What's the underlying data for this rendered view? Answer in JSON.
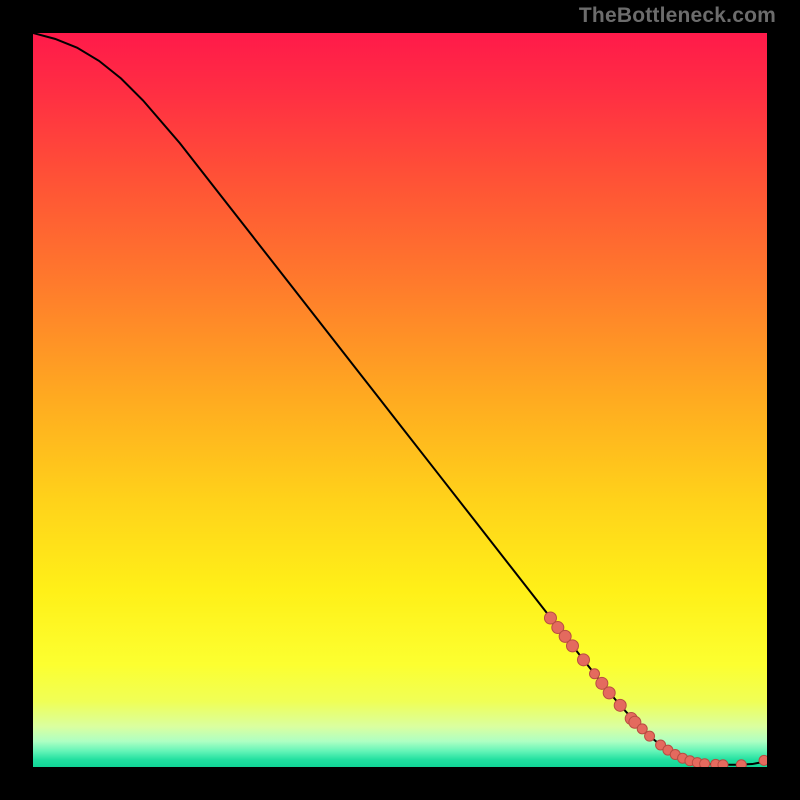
{
  "watermark": "TheBottleneck.com",
  "colors": {
    "curve": "#000000",
    "marker_fill": "#e46a5e",
    "marker_stroke": "#b94c42",
    "gradient_stops": [
      {
        "offset": 0.0,
        "color": "#ff1a4a"
      },
      {
        "offset": 0.08,
        "color": "#ff2e43"
      },
      {
        "offset": 0.2,
        "color": "#ff5236"
      },
      {
        "offset": 0.34,
        "color": "#ff7a2c"
      },
      {
        "offset": 0.5,
        "color": "#ffab20"
      },
      {
        "offset": 0.64,
        "color": "#ffd31a"
      },
      {
        "offset": 0.76,
        "color": "#fff018"
      },
      {
        "offset": 0.86,
        "color": "#fcff30"
      },
      {
        "offset": 0.91,
        "color": "#f0ff55"
      },
      {
        "offset": 0.945,
        "color": "#daffa0"
      },
      {
        "offset": 0.965,
        "color": "#aeffc3"
      },
      {
        "offset": 0.978,
        "color": "#66f5b8"
      },
      {
        "offset": 0.99,
        "color": "#22e0a0"
      },
      {
        "offset": 1.0,
        "color": "#10d596"
      }
    ]
  },
  "chart_data": {
    "type": "line",
    "title": "",
    "xlabel": "",
    "ylabel": "",
    "xlim": [
      0,
      100
    ],
    "ylim": [
      0,
      100
    ],
    "series": [
      {
        "name": "bottleneck-curve",
        "x": [
          0,
          3,
          6,
          9,
          12,
          15,
          20,
          25,
          30,
          35,
          40,
          45,
          50,
          55,
          60,
          65,
          70,
          75,
          78,
          80,
          82,
          84,
          86,
          88,
          90,
          92,
          94,
          96,
          98,
          99,
          100
        ],
        "y": [
          100,
          99.2,
          98.0,
          96.2,
          93.8,
          90.8,
          85.0,
          78.6,
          72.2,
          65.8,
          59.4,
          53.0,
          46.6,
          40.2,
          33.8,
          27.4,
          21.0,
          14.6,
          10.8,
          8.4,
          6.2,
          4.2,
          2.6,
          1.4,
          0.7,
          0.4,
          0.3,
          0.3,
          0.4,
          0.6,
          1.0
        ]
      }
    ],
    "markers": {
      "series": "bottleneck-curve",
      "points": [
        {
          "x": 70.5,
          "y": 20.3,
          "r": 6
        },
        {
          "x": 71.5,
          "y": 19.0,
          "r": 6
        },
        {
          "x": 72.5,
          "y": 17.8,
          "r": 6
        },
        {
          "x": 73.5,
          "y": 16.5,
          "r": 6
        },
        {
          "x": 75.0,
          "y": 14.6,
          "r": 6
        },
        {
          "x": 76.5,
          "y": 12.7,
          "r": 5
        },
        {
          "x": 77.5,
          "y": 11.4,
          "r": 6
        },
        {
          "x": 78.5,
          "y": 10.1,
          "r": 6
        },
        {
          "x": 80.0,
          "y": 8.4,
          "r": 6
        },
        {
          "x": 81.5,
          "y": 6.6,
          "r": 6
        },
        {
          "x": 82.0,
          "y": 6.1,
          "r": 6
        },
        {
          "x": 83.0,
          "y": 5.2,
          "r": 5
        },
        {
          "x": 84.0,
          "y": 4.2,
          "r": 5
        },
        {
          "x": 85.5,
          "y": 3.0,
          "r": 5
        },
        {
          "x": 86.5,
          "y": 2.3,
          "r": 5
        },
        {
          "x": 87.5,
          "y": 1.7,
          "r": 5
        },
        {
          "x": 88.5,
          "y": 1.2,
          "r": 5
        },
        {
          "x": 89.5,
          "y": 0.85,
          "r": 5
        },
        {
          "x": 90.5,
          "y": 0.6,
          "r": 5
        },
        {
          "x": 91.5,
          "y": 0.45,
          "r": 5
        },
        {
          "x": 93.0,
          "y": 0.35,
          "r": 5
        },
        {
          "x": 94.0,
          "y": 0.3,
          "r": 5
        },
        {
          "x": 96.5,
          "y": 0.3,
          "r": 5
        },
        {
          "x": 99.6,
          "y": 0.9,
          "r": 5
        }
      ]
    }
  }
}
